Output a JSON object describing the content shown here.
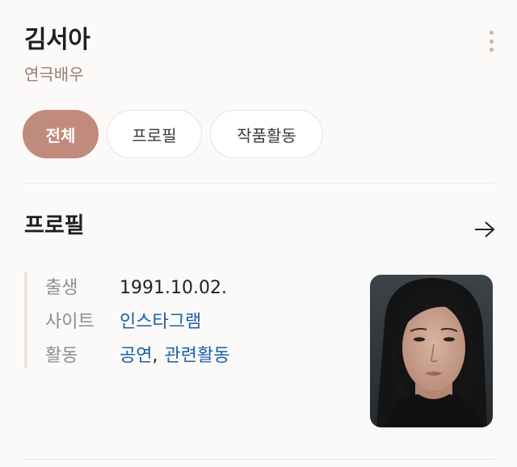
{
  "header": {
    "name": "김서아",
    "role": "연극배우",
    "more_icon": "kebab-more-icon"
  },
  "tabs": [
    {
      "label": "전체",
      "active": true
    },
    {
      "label": "프로필",
      "active": false
    },
    {
      "label": "작품활동",
      "active": false
    }
  ],
  "profile": {
    "title": "프로필",
    "arrow_icon": "arrow-right-icon",
    "rows": {
      "birth": {
        "label": "출생",
        "value": "1991.10.02."
      },
      "site": {
        "label": "사이트",
        "value": "인스타그램"
      },
      "activity": {
        "label": "활동",
        "link1": "공연",
        "separator": ",",
        "link2": "관련활동"
      }
    }
  },
  "colors": {
    "accent": "#c08b7c",
    "link": "#1a5ea8",
    "role_text": "#9a7b6d"
  }
}
